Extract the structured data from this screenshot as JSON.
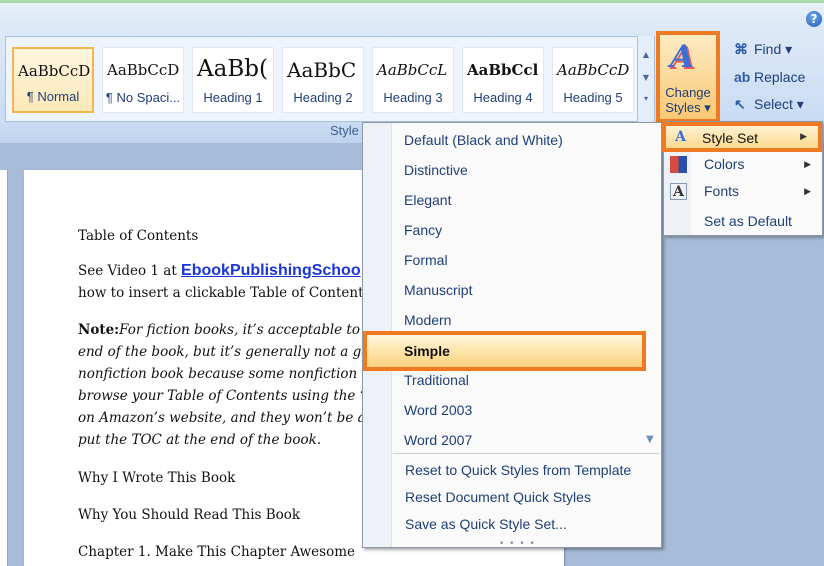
{
  "ribbon": {
    "quick_styles": [
      {
        "sample": "AaBbCcD",
        "label": "¶ Normal"
      },
      {
        "sample": "AaBbCcD",
        "label": "¶ No Spaci..."
      },
      {
        "sample": "AaBb(",
        "label": "Heading 1"
      },
      {
        "sample": "AaBbC",
        "label": "Heading 2"
      },
      {
        "sample": "AaBbCcL",
        "label": "Heading 3"
      },
      {
        "sample": "AaBbCcl",
        "label": "Heading 4"
      },
      {
        "sample": "AaBbCcD",
        "label": "Heading 5"
      }
    ],
    "group_label": "Style",
    "change_styles": {
      "line1": "Change",
      "line2": "Styles ▾"
    },
    "editing": {
      "find": "Find ▾",
      "replace": "Replace",
      "select": "Select ▾"
    },
    "help": "?"
  },
  "document": {
    "toc_heading": "Table of Contents",
    "video_line1_prefix": "See Video 1 at ",
    "video_link": "EbookPublishingSchoo",
    "video_line2": "how to insert a clickable Table of Content",
    "note_label": "Note:",
    "note_lines": [
      "For fiction books, it’s acceptable to p",
      "end of the book, but it’s generally not a go",
      "nonfiction book because some nonfiction i",
      "browse your Table of Contents using the “I",
      "on Amazon’s website, and they won’t be a",
      "put the TOC at the end of the book."
    ],
    "headings": [
      "Why I Wrote This Book",
      "Why You Should Read This Book",
      "Chapter 1. Make This Chapter  Awesome"
    ]
  },
  "style_set_menu": {
    "items": [
      "Default (Black and White)",
      "Distinctive",
      "Elegant",
      "Fancy",
      "Formal",
      "Manuscript",
      "Modern",
      "Simple",
      "Traditional",
      "Word 2003",
      "Word 2007"
    ],
    "selected": "Simple",
    "commands": [
      "Reset to Quick Styles from Template",
      "Reset Document Quick Styles",
      "Save as Quick Style Set..."
    ]
  },
  "change_styles_menu": {
    "items": [
      "Style Set",
      "Colors",
      "Fonts",
      "Set as Default"
    ],
    "highlighted": "Style Set"
  },
  "colors": {
    "highlight_border": "#f07a22",
    "link": "#1a35d9",
    "menu_text": "#1f3f78"
  }
}
